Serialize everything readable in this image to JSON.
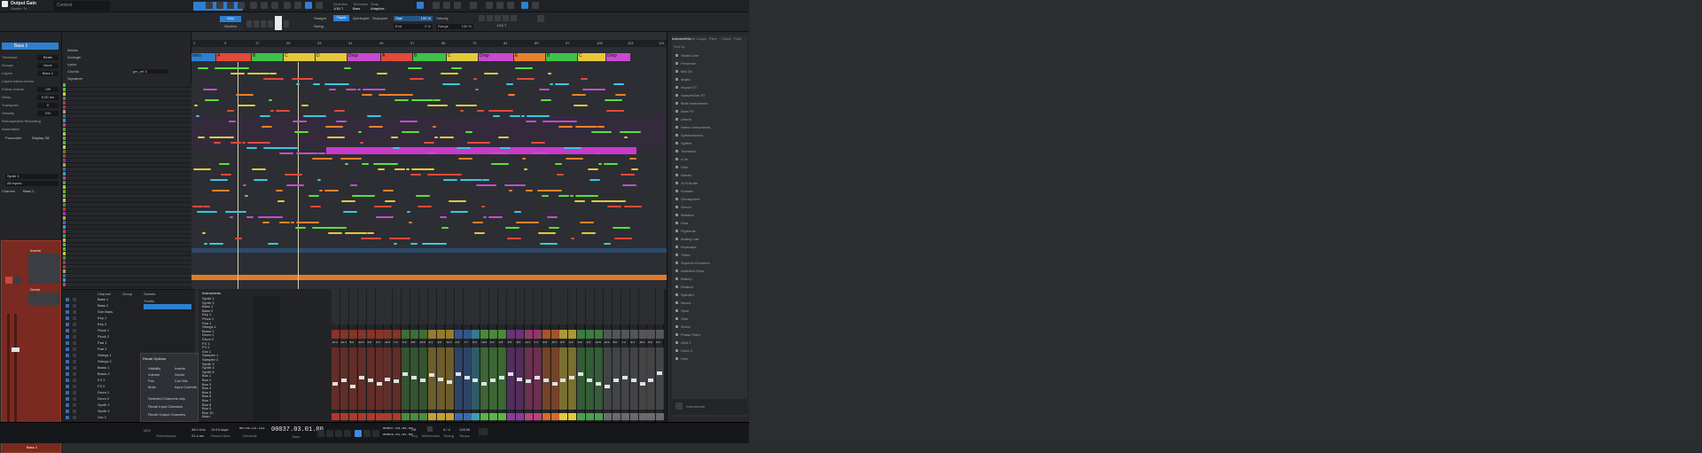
{
  "toolbar": {
    "song_title": "Output Gain",
    "song_subtitle": "Studio+ Yr",
    "context_label": "Context",
    "quantize_label": "Quantize",
    "quantize_value": "1/16 T",
    "timebase_label": "Timebase",
    "timebase_value": "Bars",
    "snap_label": "Snap",
    "snap_value": "Adaptive"
  },
  "snap_row": {
    "grid_label": "Grid",
    "shorten_label": "Shorten",
    "straight": "Straight",
    "triplet": "Triplet",
    "quintuplet": "Quintuplet",
    "septuplet": "Septuplet",
    "swing": "Swing",
    "start_label": "Start",
    "start_value": "100 %",
    "end_label": "End",
    "end_value": "0 %",
    "velocity_label": "Velocity",
    "range_label": "Range",
    "range_value": "100 %",
    "q_value": "1/16 T",
    "accent": "#2f7fd0"
  },
  "inspector": {
    "track_name": "Bass 1",
    "rows": [
      {
        "label": "Timebase",
        "value": "Beats"
      },
      {
        "label": "Groups",
        "value": "None"
      },
      {
        "label": "Layers",
        "value": "Bass 1"
      },
      {
        "label": "Layers follow events",
        "value": ""
      },
      {
        "label": "Follow chords",
        "value": "Off"
      },
      {
        "label": "Delay",
        "value": "0.00 ms"
      },
      {
        "label": "Transpose",
        "value": "0"
      },
      {
        "label": "Velocity",
        "value": "0%"
      },
      {
        "label": "Retrospective Recording",
        "value": ""
      },
      {
        "label": "Automation",
        "value": ""
      }
    ],
    "param_label": "Parameter",
    "param_value": "Display Off",
    "output_label": "Synth 1",
    "input_label": "All Inputs",
    "channel_label": "Channel",
    "channel_value": "Bass 1",
    "inserts_label": "Inserts",
    "sends_label": "Sends",
    "bottom_label": "Bass 1"
  },
  "tracklist": {
    "header": "Marker",
    "arranger": "Arranger",
    "lyrics": "Lyrics",
    "chords": "Chords",
    "signature": "Signature",
    "chords_value": "gm_rel 3",
    "track_colors": [
      "#5bb543",
      "#5bb543",
      "#d8c43a",
      "#4a8d3a",
      "#b03a3a",
      "#8a3a9a",
      "#c8a030",
      "#3a6ab0",
      "#3aa0b0",
      "#c04080",
      "#4aa04a",
      "#c8c030"
    ]
  },
  "ruler": {
    "bars": [
      "1",
      "9",
      "17",
      "25",
      "33",
      "41",
      "49",
      "57",
      "65",
      "73",
      "81",
      "89",
      "97",
      "105",
      "113",
      "121"
    ]
  },
  "markers": [
    {
      "label": "Intro",
      "color": "#2f7fd0"
    },
    {
      "label": "A",
      "color": "#e24a3a"
    },
    {
      "label": "B",
      "color": "#3ec24a"
    },
    {
      "label": "C",
      "color": "#e5c93a"
    },
    {
      "label": "D",
      "color": "#e5c93a"
    },
    {
      "label": "Drop",
      "color": "#c84ad0"
    },
    {
      "label": "A",
      "color": "#e24a3a"
    },
    {
      "label": "B",
      "color": "#3ec24a"
    },
    {
      "label": "C",
      "color": "#e5c93a"
    },
    {
      "label": "Drop",
      "color": "#c84ad0"
    },
    {
      "label": "E",
      "color": "#e8822a"
    },
    {
      "label": "B",
      "color": "#3ec24a"
    },
    {
      "label": "C",
      "color": "#e5c93a"
    },
    {
      "label": "Drop",
      "color": "#c84ad0"
    }
  ],
  "console": {
    "channel_header": "Channel",
    "group_header": "Group",
    "scenes_header": "Scenes",
    "tracks_label": "Tracks",
    "channels": [
      "Bass 1",
      "Bass 2",
      "Sub Bass",
      "Key 1",
      "Key 2",
      "Pluck 1",
      "Pluck 2",
      "Pad 1",
      "Pad 2",
      "Strings 1",
      "Strings 2",
      "Brass 1",
      "Brass 2",
      "FX 1",
      "FX 2",
      "Drum 1",
      "Drum 2",
      "Synth 1",
      "Synth 2",
      "Vox 1"
    ],
    "recall_options": "Recall Options",
    "popup_items": [
      "Visibility",
      "Volume",
      "Pan",
      "Mute",
      "Selected Channels only",
      "Recall Input Channels",
      "Recall Output Channels"
    ],
    "popup_items_right": [
      "Inserts",
      "Sends",
      "Cue Mix",
      "Input Controls"
    ]
  },
  "instruments": {
    "header": "Instruments",
    "items": [
      "Synth 1",
      "Synth 2",
      "Bass 1",
      "Bass 2",
      "Key 1",
      "Pluck 1",
      "Pad 1",
      "Strings 1",
      "Brass 1",
      "Drum 1",
      "Drum 2",
      "FX 1",
      "FX 2",
      "Vox 1",
      "Sampler 1",
      "Sampler 2",
      "Synth 3",
      "Synth 4",
      "Synth 5",
      "Bus 1",
      "Bus 2",
      "Bus 3",
      "Bus 4",
      "Bus 5",
      "Bus 6",
      "Bus 7",
      "Bus 8",
      "Bus 9",
      "Bus 10",
      "Main"
    ]
  },
  "mixer": {
    "strip_colors": [
      "#b03a2a",
      "#b03a2a",
      "#b03a2a",
      "#b03a2a",
      "#b03a2a",
      "#b03a2a",
      "#b03a2a",
      "#b03a2a",
      "#4a8d3a",
      "#4a8d3a",
      "#4a8d3a",
      "#c8a030",
      "#c8a030",
      "#c8a030",
      "#3a6ab0",
      "#3a6ab0",
      "#3aa0b0",
      "#5bb543",
      "#5bb543",
      "#5bb543",
      "#8a3a9a",
      "#8a3a9a",
      "#c04080",
      "#c04080",
      "#d86a2a",
      "#d86a2a",
      "#e5c93a",
      "#e5c93a",
      "#4aa04a",
      "#4aa04a",
      "#4aa04a",
      "#6a6a6a",
      "#6a6a6a",
      "#6a6a6a",
      "#6a6a6a",
      "#6a6a6a",
      "#6a6a6a",
      "#6a6a6a"
    ],
    "fader_levels": [
      0.45,
      0.5,
      0.4,
      0.55,
      0.5,
      0.45,
      0.52,
      0.48,
      0.6,
      0.55,
      0.5,
      0.58,
      0.52,
      0.47,
      0.6,
      0.55,
      0.5,
      0.45,
      0.5,
      0.55,
      0.6,
      0.52,
      0.48,
      0.55,
      0.5,
      0.45,
      0.5,
      0.55,
      0.6,
      0.5,
      0.45,
      0.4,
      0.5,
      0.55,
      0.5,
      0.45,
      0.5,
      0.62
    ],
    "db_values": [
      "-10.4",
      "-10.4",
      "-8.2",
      "-12.0",
      "-6.8",
      "-9.3",
      "-11.5",
      "-7.4",
      "-5.2",
      "-8.8",
      "-10.0",
      "-6.1",
      "-9.6",
      "-12.4",
      "-4.8",
      "-7.7",
      "-8.9",
      "-10.2",
      "-9.0",
      "-6.5",
      "-5.5",
      "-8.3",
      "-11.1",
      "-7.0",
      "-9.8",
      "-10.7",
      "-8.5",
      "-6.9",
      "-5.9",
      "-9.1",
      "-10.6",
      "-12.2",
      "-8.0",
      "-7.2",
      "-9.4",
      "-10.1",
      "-8.6",
      "0.0"
    ]
  },
  "browser": {
    "tabs": [
      "Instruments",
      "Effects",
      "Loops",
      "Files",
      "Cloud",
      "Pool"
    ],
    "sort_label": "Sort by",
    "items": [
      "Studio One",
      "Presence",
      "Mai Tai",
      "Mojito",
      "Impact XT",
      "SampleOne XT",
      "Multi Instruments",
      "Note FX",
      "Arturia",
      "Native Instruments",
      "Spectrasonics",
      "Spitfire",
      "Toontrack",
      "u-he",
      "Vital",
      "Waves",
      "XLN Audio",
      "Kontakt",
      "Omnisphere",
      "Serum",
      "Massive",
      "Diva",
      "Pigments",
      "Analog Lab",
      "Keyscape",
      "Trilian",
      "Superior Drummer",
      "Addictive Keys",
      "Battery",
      "Reaktor",
      "Sylenth1",
      "Nexus",
      "Spire",
      "Vital",
      "Zebra",
      "Phase Plant",
      "ANA 2",
      "Dune 3",
      "Hive",
      "Avenger"
    ],
    "footer_label": "Instruments"
  },
  "transport": {
    "midi_label": "MIDI",
    "perf_label": "Performance",
    "sample_rate": "48.0 kHz",
    "latency": "21.4 ms",
    "record_max": "13:19 days",
    "record_label": "Record Max",
    "seconds_time": "00:01:21.111",
    "seconds_label": "Seconds",
    "bars_time": "00037.03.01.00",
    "bars_label": "Bars",
    "loop_start": "00007.04.04.00",
    "loop_end": "00055.01.01.00",
    "metronome_label": "Metronome",
    "timing_label": "Timing",
    "key_label": "Key",
    "key_value": "Off",
    "time_sig": "4 / 4",
    "tempo_label": "Tempo",
    "tempo_value": "128.00"
  }
}
